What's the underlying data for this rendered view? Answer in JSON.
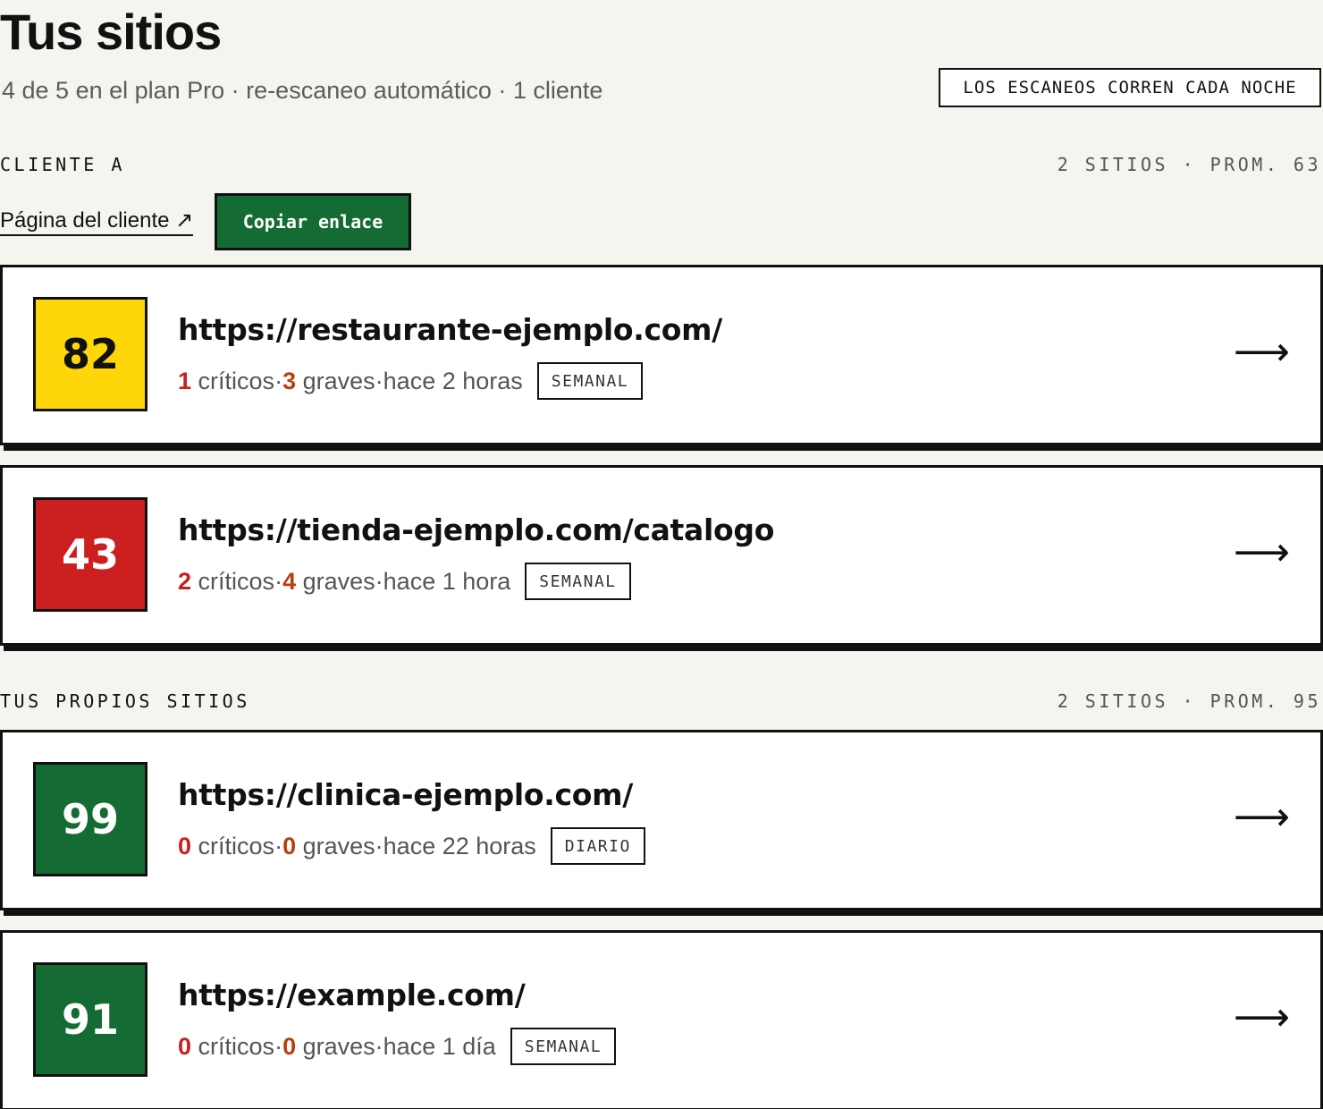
{
  "header": {
    "title": "Tus sitios",
    "subtitle": "4 de 5 en el plan Pro · re-escaneo automático · 1 cliente",
    "nightly_badge": "LOS ESCANEOS CORREN CADA NOCHE"
  },
  "groups": [
    {
      "label": "CLIENTE A",
      "meta": "2 SITIOS · PROM. 63",
      "client_link": "Página del cliente ↗",
      "copy_button": "Copiar enlace",
      "sites": [
        {
          "score": "82",
          "score_color": "#ffd60a",
          "score_text_color": "#111111",
          "url": "https://restaurante-ejemplo.com/",
          "criticos": "1",
          "criticos_label": "críticos",
          "graves": "3",
          "graves_label": "graves",
          "time": "hace 2 horas",
          "frequency": "SEMANAL",
          "arrow": "⟶"
        },
        {
          "score": "43",
          "score_color": "#cc1f1f",
          "score_text_color": "#ffffff",
          "url": "https://tienda-ejemplo.com/catalogo",
          "criticos": "2",
          "criticos_label": "críticos",
          "graves": "4",
          "graves_label": "graves",
          "time": "hace 1 hora",
          "frequency": "SEMANAL",
          "arrow": "⟶"
        }
      ]
    },
    {
      "label": "TUS PROPIOS SITIOS",
      "meta": "2 SITIOS · PROM. 95",
      "sites": [
        {
          "score": "99",
          "score_color": "#146c34",
          "score_text_color": "#ffffff",
          "url": "https://clinica-ejemplo.com/",
          "criticos": "0",
          "criticos_label": "críticos",
          "graves": "0",
          "graves_label": "graves",
          "time": "hace 22 horas",
          "frequency": "DIARIO",
          "arrow": "⟶"
        },
        {
          "score": "91",
          "score_color": "#146c34",
          "score_text_color": "#ffffff",
          "url": "https://example.com/",
          "criticos": "0",
          "criticos_label": "críticos",
          "graves": "0",
          "graves_label": "graves",
          "time": "hace 1 día",
          "frequency": "SEMANAL",
          "arrow": "⟶"
        }
      ]
    }
  ],
  "separator": " · "
}
